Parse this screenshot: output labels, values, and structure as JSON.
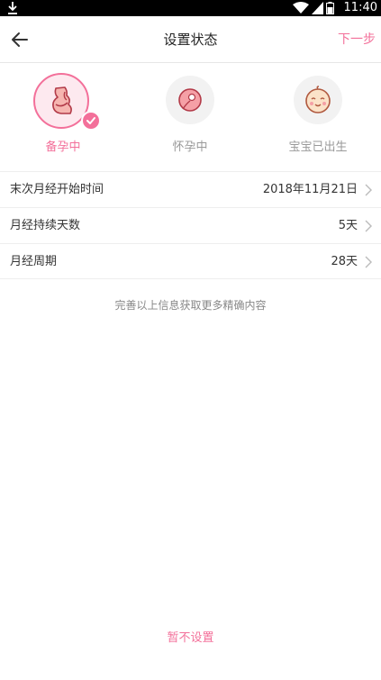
{
  "status_bar": {
    "time": "11:40"
  },
  "nav": {
    "title": "设置状态",
    "next_label": "下一步"
  },
  "states": [
    {
      "label": "备孕中",
      "selected": true,
      "icon": "pregnancy-prep-icon"
    },
    {
      "label": "怀孕中",
      "selected": false,
      "icon": "fertilized-egg-icon"
    },
    {
      "label": "宝宝已出生",
      "selected": false,
      "icon": "baby-face-icon"
    }
  ],
  "settings": [
    {
      "label": "末次月经开始时间",
      "value": "2018年11月21日"
    },
    {
      "label": "月经持续天数",
      "value": "5天"
    },
    {
      "label": "月经周期",
      "value": "28天"
    }
  ],
  "hint": "完善以上信息获取更多精确内容",
  "skip_label": "暂不设置",
  "colors": {
    "accent": "#f3709a",
    "accent_light": "#fde9ef"
  }
}
